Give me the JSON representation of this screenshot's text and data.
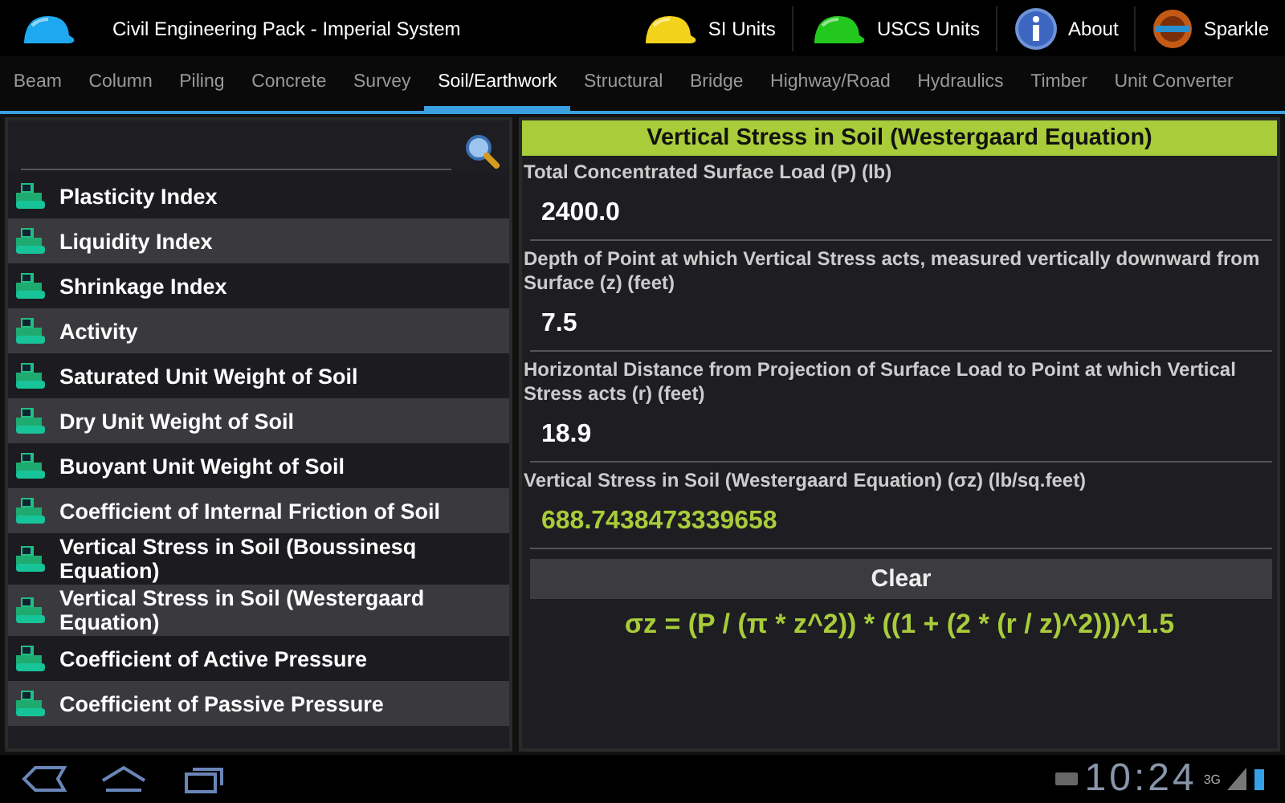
{
  "app_bar": {
    "title": "Civil Engineering Pack - Imperial System",
    "actions": [
      {
        "label": "SI Units",
        "kind": "helmet",
        "color": "#f2d21a"
      },
      {
        "label": "USCS Units",
        "kind": "helmet",
        "color": "#22c81e"
      },
      {
        "label": "About",
        "kind": "info"
      },
      {
        "label": "Sparkle",
        "kind": "logo"
      }
    ]
  },
  "tabs": [
    {
      "label": "Beam",
      "selected": false
    },
    {
      "label": "Column",
      "selected": false
    },
    {
      "label": "Piling",
      "selected": false
    },
    {
      "label": "Concrete",
      "selected": false
    },
    {
      "label": "Survey",
      "selected": false
    },
    {
      "label": "Soil/Earthwork",
      "selected": true
    },
    {
      "label": "Structural",
      "selected": false
    },
    {
      "label": "Bridge",
      "selected": false
    },
    {
      "label": "Highway/Road",
      "selected": false
    },
    {
      "label": "Hydraulics",
      "selected": false
    },
    {
      "label": "Timber",
      "selected": false
    },
    {
      "label": "Unit Converter",
      "selected": false
    }
  ],
  "sidebar": {
    "items": [
      {
        "label": "Plasticity Index"
      },
      {
        "label": "Liquidity Index"
      },
      {
        "label": "Shrinkage Index"
      },
      {
        "label": "Activity"
      },
      {
        "label": "Saturated Unit Weight of Soil"
      },
      {
        "label": "Dry Unit Weight of Soil"
      },
      {
        "label": "Buoyant Unit Weight of Soil"
      },
      {
        "label": "Coefficient of Internal Friction of Soil"
      },
      {
        "label": "Vertical Stress in Soil (Boussinesq Equation)"
      },
      {
        "label": "Vertical Stress in Soil (Westergaard Equation)"
      },
      {
        "label": "Coefficient of Active Pressure"
      },
      {
        "label": "Coefficient of Passive Pressure"
      }
    ]
  },
  "calculator": {
    "title": "Vertical Stress in Soil (Westergaard Equation)",
    "fields": [
      {
        "label": "Total Concentrated Surface Load (P) (lb)",
        "value": "2400.0",
        "kind": "input"
      },
      {
        "label": "Depth of Point at which Vertical Stress acts, measured vertically downward from Surface (z) (feet)",
        "value": "7.5",
        "kind": "input"
      },
      {
        "label": "Horizontal Distance from Projection of Surface Load to Point at which Vertical Stress acts (r) (feet)",
        "value": "18.9",
        "kind": "input"
      },
      {
        "label": "Vertical Stress in Soil (Westergaard Equation) (σz) (lb/sq.feet)",
        "value": "688.7438473339658",
        "kind": "result"
      }
    ],
    "button": "Clear",
    "formula": "σz = (P / (π * z^2)) * ((1 + (2 * (r / z)^2)))^1.5"
  },
  "system_bar": {
    "clock": "10:24",
    "network": "3G"
  }
}
